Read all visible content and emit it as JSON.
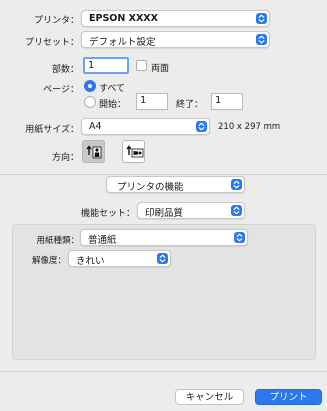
{
  "printer": {
    "label": "プリンタ：",
    "value": "EPSON XXXX"
  },
  "preset": {
    "label": "プリセット：",
    "value": "デフォルト設定"
  },
  "copies": {
    "label": "部数：",
    "value": "1",
    "duplex_label": "両面"
  },
  "pages": {
    "label": "ページ：",
    "all_label": "すべて",
    "start_label": "開始：",
    "start_value": "1",
    "end_label": "終了：",
    "end_value": "1"
  },
  "paper_size": {
    "label": "用紙サイズ：",
    "value": "A4",
    "dimensions": "210 x 297 mm"
  },
  "orientation": {
    "label": "方向："
  },
  "section": {
    "value": "プリンタの機能"
  },
  "feature_set": {
    "label": "機能セット：",
    "value": "印刷品質"
  },
  "media_type": {
    "label": "用紙種類：",
    "value": "普通紙"
  },
  "resolution": {
    "label": "解像度：",
    "value": "きれい"
  },
  "footer": {
    "cancel_label": "キャンセル",
    "print_label": "プリント"
  },
  "colors": {
    "accent": "#2c78f0",
    "panel": "#e3e3e3"
  }
}
